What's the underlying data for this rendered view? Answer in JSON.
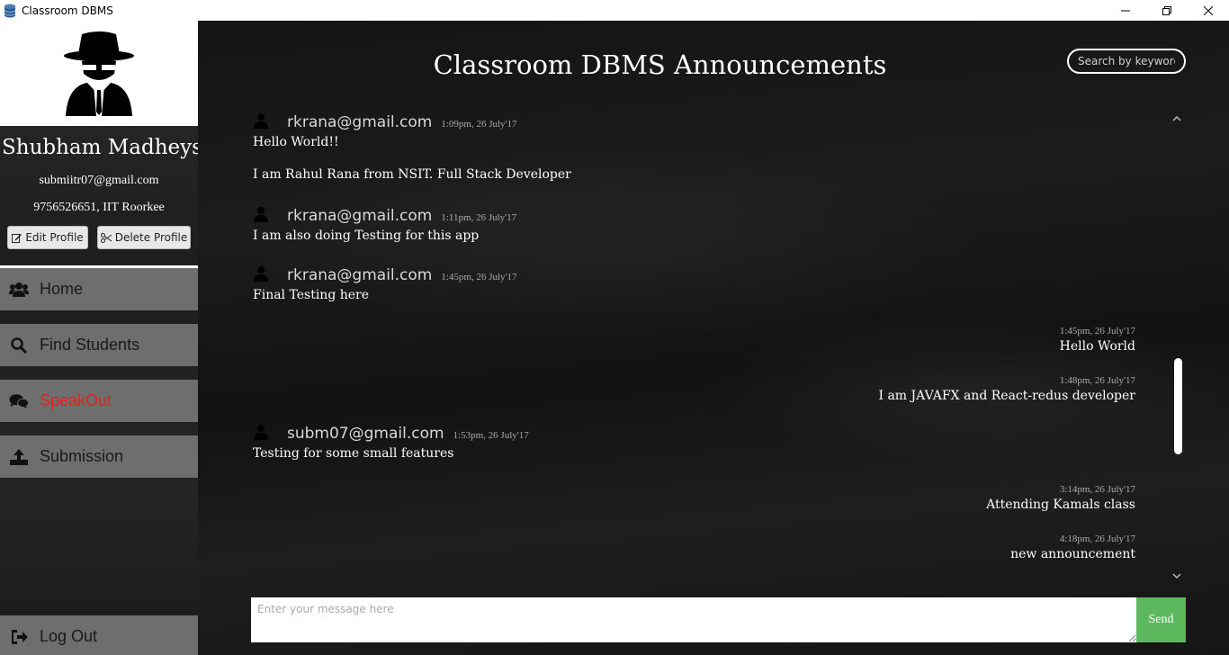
{
  "window": {
    "title": "Classroom DBMS"
  },
  "profile": {
    "name": "Shubham Madheys...",
    "email": "submiitr07@gmail.com",
    "phone_college": "9756526651,  IIT Roorkee",
    "edit_label": "Edit Profile",
    "delete_label": "Delete Profile"
  },
  "nav": {
    "home": "Home",
    "find": "Find Students",
    "speakout": "SpeakOut",
    "submission": "Submission",
    "logout": "Log Out"
  },
  "colors": {
    "active_nav": "#e8201c",
    "nav_bg": "#6e6e6e",
    "send_bg": "#5cb85c"
  },
  "main": {
    "title": "Classroom DBMS Announcements",
    "search_placeholder": "Search by keyword",
    "input_placeholder": "Enter your message here",
    "send_label": "Send"
  },
  "messages": {
    "m1": {
      "email": "rkrana@gmail.com",
      "time": "1:09pm, 26 July'17",
      "line1": "Hello World!!",
      "line2": "I am Rahul Rana from NSIT. Full Stack Developer"
    },
    "m2": {
      "email": "rkrana@gmail.com",
      "time": "1:11pm, 26 July'17",
      "text": "I am also doing Testing for this app"
    },
    "m3": {
      "email": "rkrana@gmail.com",
      "time": "1:45pm, 26 July'17",
      "text": "Final Testing here"
    },
    "r1": {
      "time": "1:45pm, 26 July'17",
      "text": "Hello World"
    },
    "r2": {
      "time": "1:48pm, 26 July'17",
      "text": "I am JAVAFX and React-redus developer"
    },
    "m4": {
      "email": "subm07@gmail.com",
      "time": "1:53pm, 26 July'17",
      "text": "Testing for some small features"
    },
    "r3": {
      "time": "3:14pm, 26 July'17",
      "text": "Attending Kamals class"
    },
    "r4": {
      "time": "4:18pm, 26 July'17",
      "text": "new announcement"
    }
  }
}
